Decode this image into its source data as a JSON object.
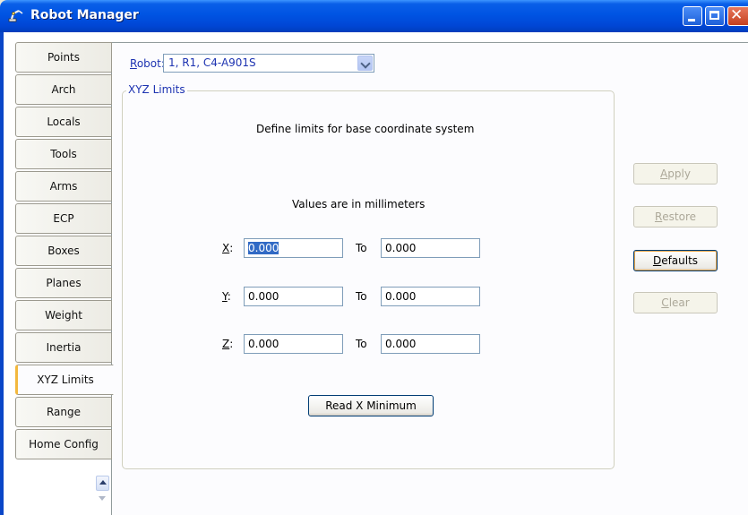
{
  "window": {
    "title": "Robot Manager",
    "icon": "robot-arm-icon"
  },
  "tabs": [
    {
      "label": "Points",
      "active": false
    },
    {
      "label": "Arch",
      "active": false
    },
    {
      "label": "Locals",
      "active": false
    },
    {
      "label": "Tools",
      "active": false
    },
    {
      "label": "Arms",
      "active": false
    },
    {
      "label": "ECP",
      "active": false
    },
    {
      "label": "Boxes",
      "active": false
    },
    {
      "label": "Planes",
      "active": false
    },
    {
      "label": "Weight",
      "active": false
    },
    {
      "label": "Inertia",
      "active": false
    },
    {
      "label": "XYZ Limits",
      "active": true
    },
    {
      "label": "Range",
      "active": false
    },
    {
      "label": "Home Config",
      "active": false
    }
  ],
  "robot": {
    "label_mnemonic": "R",
    "label_rest": "obot:",
    "value": "1, R1, C4-A901S"
  },
  "group": {
    "title": "XYZ Limits",
    "description": "Define limits for base coordinate system",
    "units_note": "Values are in millimeters",
    "rows": [
      {
        "axis": "X",
        "suffix": ":",
        "from": "0.000",
        "to_label": "To",
        "to": "0.000"
      },
      {
        "axis": "Y",
        "suffix": ":",
        "from": "0.000",
        "to_label": "To",
        "to": "0.000"
      },
      {
        "axis": "Z",
        "suffix": ":",
        "from": "0.000",
        "to_label": "To",
        "to": "0.000"
      }
    ],
    "read_button": "Read X Minimum"
  },
  "actions": {
    "apply": {
      "mnemonic": "A",
      "rest": "pply",
      "enabled": false
    },
    "restore": {
      "mnemonic": "R",
      "rest": "estore",
      "enabled": false
    },
    "defaults": {
      "mnemonic": "D",
      "rest": "efaults",
      "enabled": true
    },
    "clear": {
      "mnemonic": "C",
      "rest": "lear",
      "enabled": false
    }
  },
  "colors": {
    "accent": "#1d33b1",
    "title_bar": "#0054e3",
    "active_tab_marker": "#f3b83d"
  }
}
